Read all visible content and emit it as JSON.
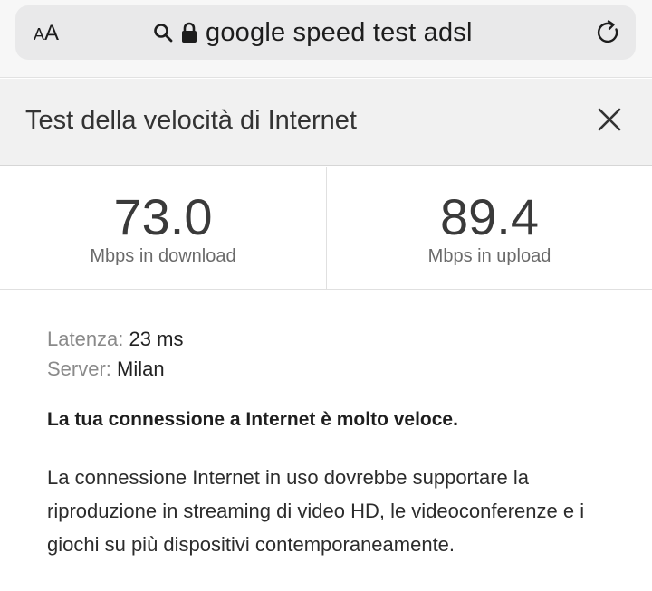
{
  "browser": {
    "text_size_button_large": "A",
    "text_size_button_small": "A",
    "address_text": "google speed test adsl",
    "icons": [
      "search-icon",
      "lock-icon",
      "reload-icon"
    ]
  },
  "panel": {
    "title": "Test della velocità di Internet",
    "close_icon": "close-icon"
  },
  "results": {
    "download": {
      "value": "73.0",
      "label": "Mbps in download"
    },
    "upload": {
      "value": "89.4",
      "label": "Mbps in upload"
    }
  },
  "details": {
    "latency_label": "Latenza:",
    "latency_value": "23 ms",
    "server_label": "Server:",
    "server_value": "Milan"
  },
  "verdict": "La tua connessione a Internet è molto veloce.",
  "description": "La connessione Internet in uso dovrebbe supportare la riproduzione in streaming di video HD, le videoconferenze e i giochi su più dispositivi contemporaneamente."
}
